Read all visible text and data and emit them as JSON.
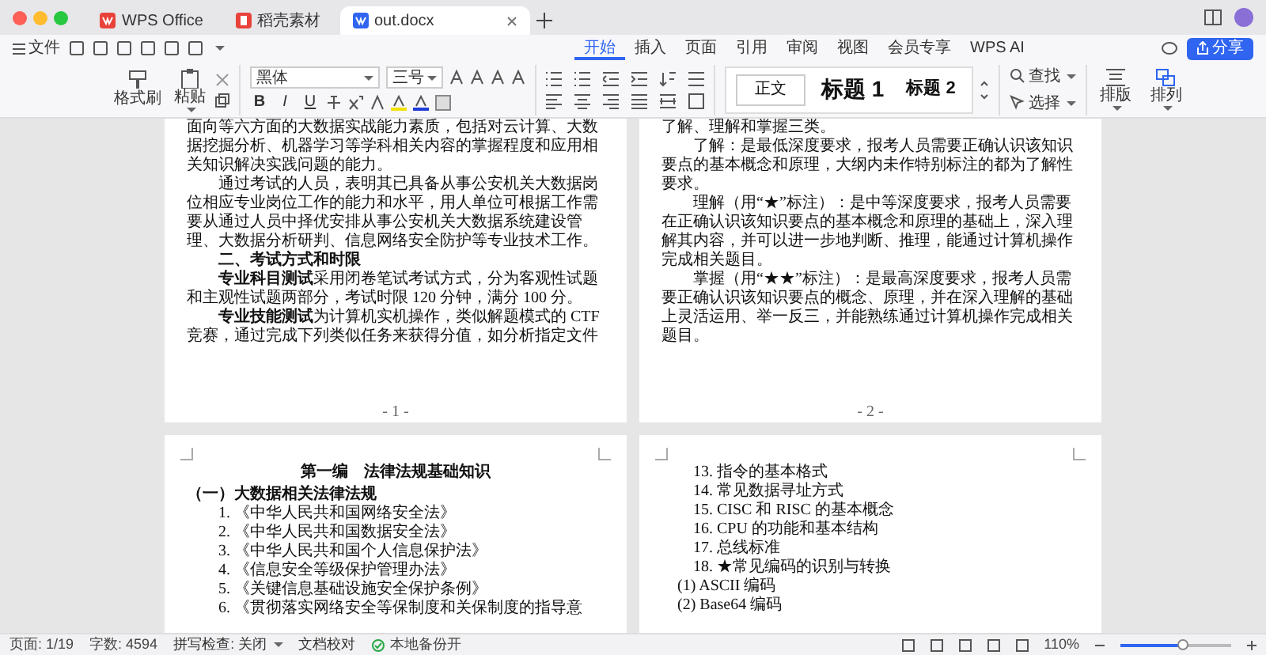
{
  "window": {
    "tabs": [
      {
        "label": "WPS Office",
        "kind": "wps",
        "selected": false
      },
      {
        "label": "稻壳素材",
        "kind": "docer",
        "selected": false
      },
      {
        "label": "out.docx",
        "kind": "doc",
        "selected": true
      }
    ]
  },
  "menu": {
    "file": "文件",
    "ribbon_tabs": [
      {
        "label": "开始",
        "selected": true
      },
      {
        "label": "插入",
        "selected": false
      },
      {
        "label": "页面",
        "selected": false
      },
      {
        "label": "引用",
        "selected": false
      },
      {
        "label": "审阅",
        "selected": false
      },
      {
        "label": "视图",
        "selected": false
      },
      {
        "label": "会员专享",
        "selected": false
      },
      {
        "label": "WPS AI",
        "selected": false
      }
    ],
    "share": "分享"
  },
  "ribbon": {
    "format_painter": "格式刷",
    "paste": "粘贴",
    "font_name": "黑体",
    "font_size": "三号",
    "format_buttons": [
      "B",
      "I",
      "U"
    ],
    "styles": [
      {
        "label": "正文",
        "kind": "normal",
        "selected": true
      },
      {
        "label": "标题 1",
        "kind": "heading1",
        "selected": false
      },
      {
        "label": "标题 2",
        "kind": "heading2",
        "selected": false
      }
    ],
    "find": "查找",
    "select": "选择",
    "layout": "排版",
    "arrange": "排列"
  },
  "pages": [
    {
      "number": "- 1 -",
      "blocks": [
        {
          "kind": "cont",
          "text": "面向等六方面的大数据实战能力素质，包括对云计算、大数据挖掘分析、机器学习等学科相关内容的掌握程度和应用相关知识解决实践问题的能力。"
        },
        {
          "kind": "para",
          "text": "通过考试的人员，表明其已具备从事公安机关大数据岗位相应专业岗位工作的能力和水平，用人单位可根据工作需要从通过人员中择优安排从事公安机关大数据系统建设管理、大数据分析研判、信息网络安全防护等专业技术工作。"
        },
        {
          "kind": "heading",
          "text": "二、考试方式和时限"
        },
        {
          "kind": "para",
          "text": "**专业科目测试**采用闭卷笔试考试方式，分为客观性试题和主观性试题两部分，考试时限 120 分钟，满分 100 分。"
        },
        {
          "kind": "para",
          "text": "**专业技能测试**为计算机实机操作，类似解题模式的 CTF 竞赛，通过完成下列类似任务来获得分值，如分析指定文件"
        }
      ]
    },
    {
      "number": "- 2 -",
      "blocks": [
        {
          "kind": "cont",
          "text": "了解、理解和掌握三类。"
        },
        {
          "kind": "para",
          "text": "了解：是最低深度要求，报考人员需要正确认识该知识要点的基本概念和原理，大纲内未作特别标注的都为了解性要求。"
        },
        {
          "kind": "para",
          "text": "理解（用“★”标注）：是中等深度要求，报考人员需要在正确认识该知识要点的基本概念和原理的基础上，深入理解其内容，并可以进一步地判断、推理，能通过计算机操作完成相关题目。"
        },
        {
          "kind": "para",
          "text": "掌握（用“★★”标注）：是最高深度要求，报考人员需要正确认识该知识要点的概念、原理，并在深入理解的基础上灵活运用、举一反三，并能熟练通过计算机操作完成相关题目。"
        }
      ]
    },
    {
      "blocks": [
        {
          "kind": "title",
          "text": "第一编　法律法规基础知识"
        },
        {
          "kind": "subheading",
          "text": "（一）大数据相关法律法规"
        },
        {
          "kind": "item",
          "text": "1. 《中华人民共和国网络安全法》"
        },
        {
          "kind": "item",
          "text": "2. 《中华人民共和国数据安全法》"
        },
        {
          "kind": "item",
          "text": "3. 《中华人民共和国个人信息保护法》"
        },
        {
          "kind": "item",
          "text": "4. 《信息安全等级保护管理办法》"
        },
        {
          "kind": "item",
          "text": "5. 《关键信息基础设施安全保护条例》"
        },
        {
          "kind": "item",
          "text": "6. 《贯彻落实网络安全等保制度和关保制度的指导意"
        }
      ]
    },
    {
      "blocks": [
        {
          "kind": "item",
          "text": "13. 指令的基本格式"
        },
        {
          "kind": "item",
          "text": "14. 常见数据寻址方式"
        },
        {
          "kind": "item",
          "text": "15. CISC 和 RISC 的基本概念"
        },
        {
          "kind": "item",
          "text": "16. CPU 的功能和基本结构"
        },
        {
          "kind": "item",
          "text": "17. 总线标准"
        },
        {
          "kind": "item",
          "text": "18. ★常见编码的识别与转换"
        },
        {
          "kind": "subitem",
          "text": "(1) ASCII 编码"
        },
        {
          "kind": "subitem",
          "text": "(2) Base64 编码"
        }
      ]
    }
  ],
  "status_bar": {
    "page": "页面: 1/19",
    "words": "字数: 4594",
    "spell": "拼写检查: 关闭",
    "proofread": "文档校对",
    "backup": "本地备份开",
    "zoom": "110%",
    "zoom_slider": {
      "level": 0.55
    }
  }
}
